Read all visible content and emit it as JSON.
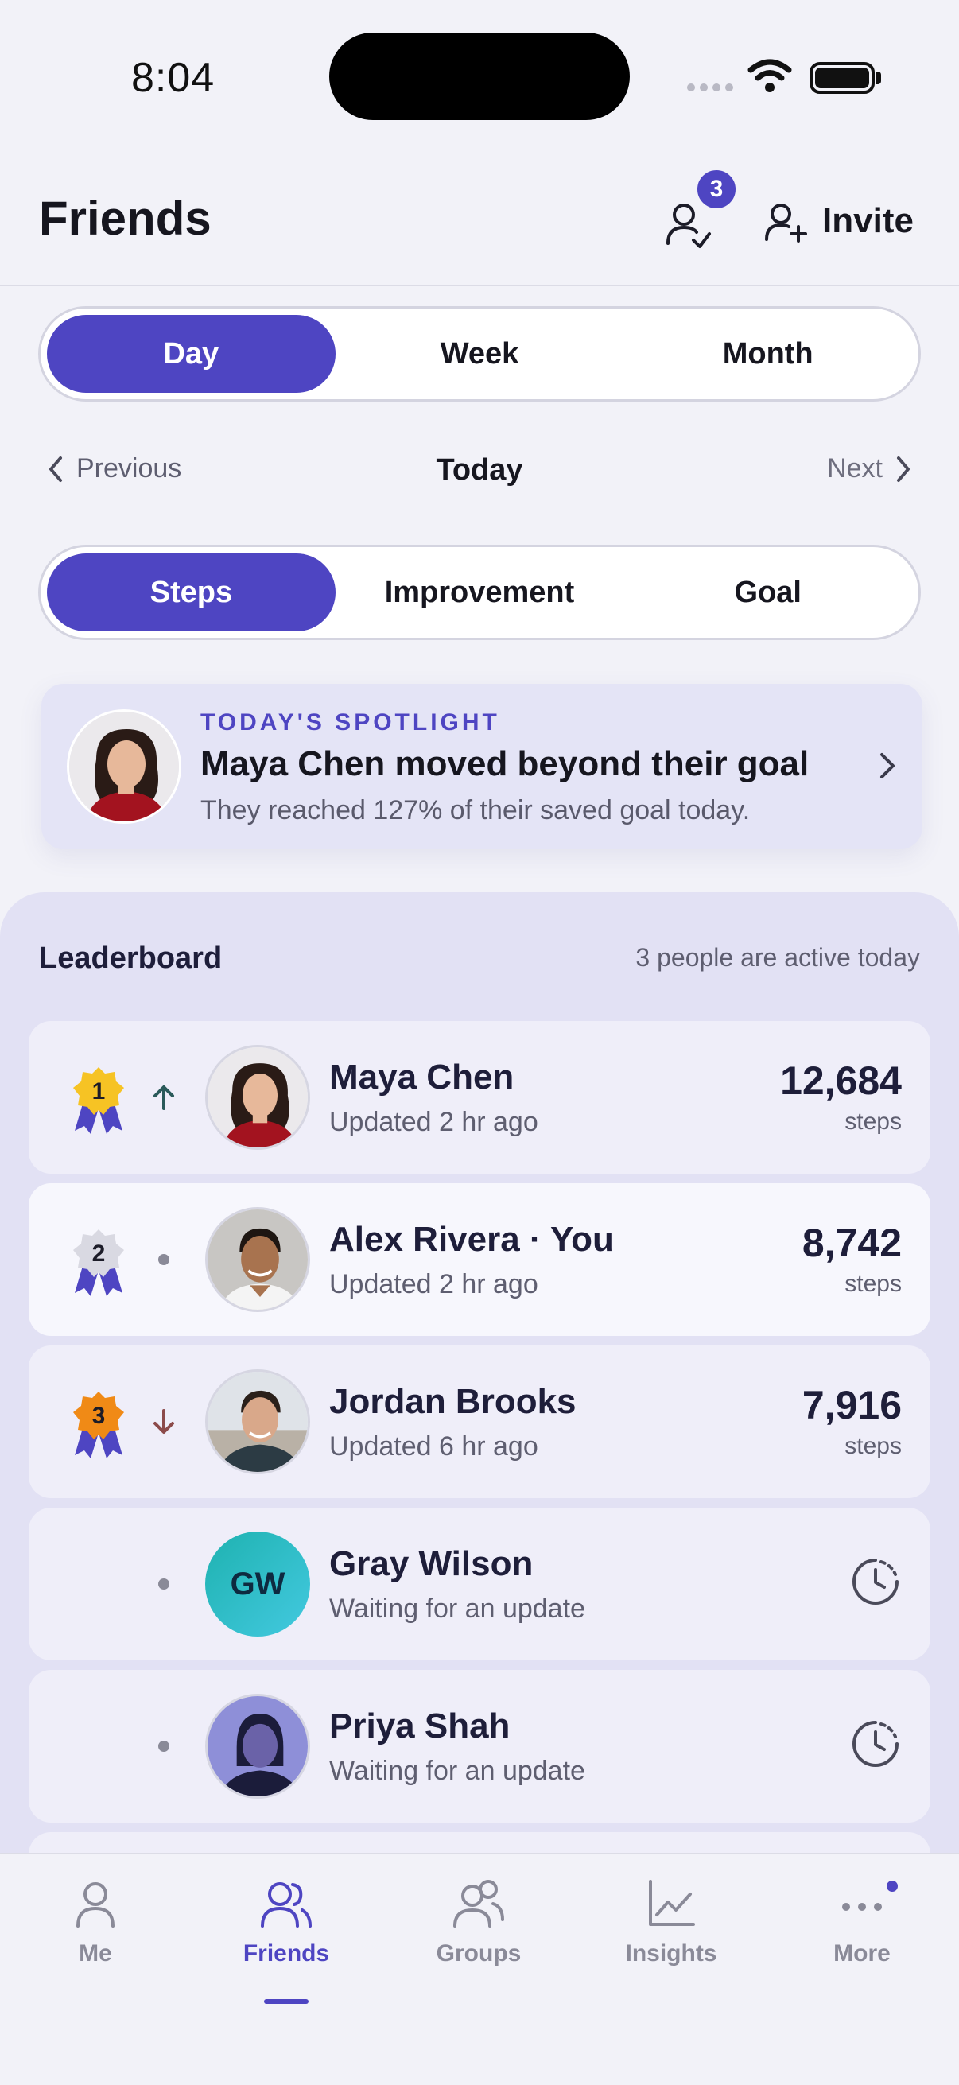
{
  "status_bar": {
    "time": "8:04"
  },
  "header": {
    "title": "Friends",
    "requests_badge": "3",
    "invite_label": "Invite"
  },
  "period_tabs": [
    {
      "label": "Day",
      "active": true
    },
    {
      "label": "Week",
      "active": false
    },
    {
      "label": "Month",
      "active": false
    }
  ],
  "date_nav": {
    "previous": "Previous",
    "current": "Today",
    "next": "Next"
  },
  "metric_tabs": [
    {
      "label": "Steps",
      "active": true
    },
    {
      "label": "Improvement",
      "active": false
    },
    {
      "label": "Goal",
      "active": false
    }
  ],
  "spotlight": {
    "kicker": "TODAY'S SPOTLIGHT",
    "title": "Maya Chen moved beyond their goal",
    "subtitle": "They reached 127% of their saved goal today."
  },
  "leaderboard": {
    "title": "Leaderboard",
    "meta": "3 people are active today",
    "rows": [
      {
        "rank": "1",
        "medal": "gold",
        "trend": "up",
        "name": "Maya Chen",
        "updated": "Updated 2 hr ago",
        "value": "12,684",
        "unit": "steps"
      },
      {
        "rank": "2",
        "medal": "silver",
        "trend": "same",
        "name": "Alex Rivera · You",
        "updated": "Updated 2 hr ago",
        "value": "8,742",
        "unit": "steps"
      },
      {
        "rank": "3",
        "medal": "bronze",
        "trend": "down",
        "name": "Jordan Brooks",
        "updated": "Updated 6 hr ago",
        "value": "7,916",
        "unit": "steps"
      },
      {
        "rank": "",
        "medal": "none",
        "trend": "same",
        "name": "Gray Wilson",
        "initials": "GW",
        "updated": "Waiting for an update",
        "value": "",
        "unit": ""
      },
      {
        "rank": "",
        "medal": "none",
        "trend": "same",
        "name": "Priya Shah",
        "updated": "Waiting for an update",
        "value": "",
        "unit": ""
      }
    ]
  },
  "tab_bar": [
    {
      "label": "Me",
      "icon": "person-icon",
      "active": false
    },
    {
      "label": "Friends",
      "icon": "friends-icon",
      "active": true
    },
    {
      "label": "Groups",
      "icon": "groups-icon",
      "active": false
    },
    {
      "label": "Insights",
      "icon": "chart-icon",
      "active": false
    },
    {
      "label": "More",
      "icon": "more-icon",
      "active": false
    }
  ],
  "colors": {
    "accent": "#4e45c2",
    "gold": "#f6c324",
    "silver": "#d9d9e2",
    "bronze": "#f08a16",
    "trend_up": "#2a5a5a",
    "trend_down": "#8c4b4b"
  }
}
